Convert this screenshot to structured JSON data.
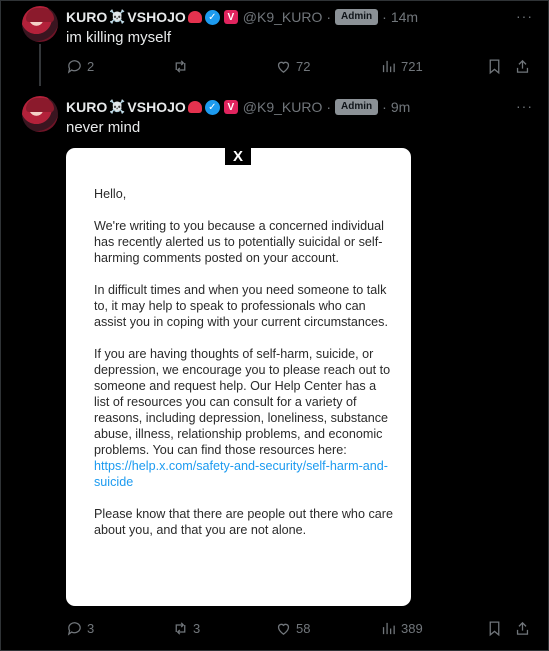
{
  "tweets": [
    {
      "name": "KURO",
      "name_emoji": "☠️",
      "name_suffix": "VSHOJO",
      "handle": "@K9_KURO",
      "badge": "Admin",
      "time": "14m",
      "text": "im killing myself",
      "actions": {
        "replies": "2",
        "retweets": "",
        "likes": "72",
        "views": "721"
      }
    },
    {
      "name": "KURO",
      "name_emoji": "☠️",
      "name_suffix": "VSHOJO",
      "handle": "@K9_KURO",
      "badge": "Admin",
      "time": "9m",
      "text": "never mind",
      "actions": {
        "replies": "3",
        "retweets": "3",
        "likes": "58",
        "views": "389"
      },
      "image": {
        "logo": "X",
        "greeting": "Hello,",
        "para1": "We're writing to you because a concerned individual has recently alerted us to potentially suicidal or self-harming comments posted on your account.",
        "para2": "In difficult times and when you need someone to talk to, it may help to speak to professionals who can assist you in coping with your current circumstances.",
        "para3": "If you are having thoughts of self-harm, suicide, or depression, we encourage you to please reach out to someone and request help. Our Help Center has a list of resources you can consult for a variety of reasons, including depression, loneliness, substance abuse, illness, relationship problems, and economic problems. You can find those resources here:",
        "link": "https://help.x.com/safety-and-security/self-harm-and-suicide",
        "para4": "Please know that there are people out there who care about you, and that you are not alone."
      }
    }
  ],
  "more_label": "···",
  "separator": "·",
  "verified_glyph": "✓",
  "vtuber_glyph": "V",
  "colors": {
    "background": "#000000",
    "accent": "#1d9bf0",
    "muted": "#71767b",
    "badge": "#8b9196"
  }
}
